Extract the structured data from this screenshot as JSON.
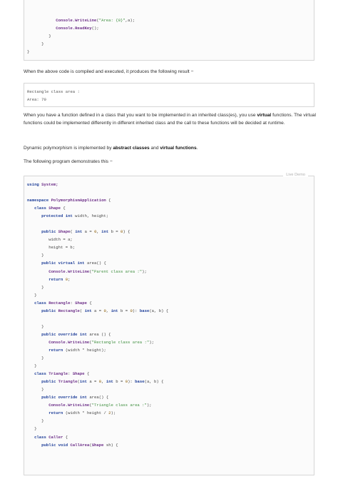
{
  "top_code": {
    "lines": [
      {
        "segs": [
          {
            "t": "            ",
            "c": ""
          },
          {
            "t": "Console.WriteLine",
            "c": "ty"
          },
          {
            "t": "(",
            "c": ""
          },
          {
            "t": "\"Area: {0}\"",
            "c": "str"
          },
          {
            "t": ",a);",
            "c": ""
          }
        ]
      },
      {
        "segs": [
          {
            "t": "            ",
            "c": ""
          },
          {
            "t": "Console.ReadKey",
            "c": "ty"
          },
          {
            "t": "();",
            "c": ""
          }
        ]
      },
      {
        "segs": [
          {
            "t": "         }",
            "c": ""
          }
        ]
      },
      {
        "segs": [
          {
            "t": "      }",
            "c": ""
          }
        ]
      },
      {
        "segs": [
          {
            "t": "}",
            "c": ""
          }
        ]
      }
    ]
  },
  "intro_text": "When the above code is compiled and executed, it produces the following result −",
  "result_box": {
    "lines": [
      {
        "segs": [
          {
            "t": "Rectangle class area :",
            "c": ""
          }
        ]
      },
      {
        "segs": [
          {
            "t": "Area: 70",
            "c": ""
          }
        ]
      }
    ]
  },
  "para1": {
    "before": "When you have a function defined in a class that you want to be implemented in an inherited class(es), you use ",
    "bold": "virtual",
    "after": " functions. The virtual functions could be implemented differently in different inherited class and the call to these functions will be decided at runtime."
  },
  "para2": {
    "before": "Dynamic polymorphism is implemented by ",
    "bold1": "abstract classes",
    "middle": " and ",
    "bold2": "virtual functions",
    "after": "."
  },
  "para3": "The following program demonstrates this −",
  "live_demo_label": "Live Demo",
  "main_code": {
    "lines": [
      {
        "segs": [
          {
            "t": "using",
            "c": "kw"
          },
          {
            "t": " ",
            "c": ""
          },
          {
            "t": "System;",
            "c": "ty"
          }
        ]
      },
      {
        "segs": []
      },
      {
        "segs": [
          {
            "t": "namespace",
            "c": "kw"
          },
          {
            "t": " ",
            "c": ""
          },
          {
            "t": "PolymorphismApplication",
            "c": "ty"
          },
          {
            "t": " {",
            "c": ""
          }
        ]
      },
      {
        "segs": [
          {
            "t": "   ",
            "c": ""
          },
          {
            "t": "class",
            "c": "kw"
          },
          {
            "t": " ",
            "c": ""
          },
          {
            "t": "Shape",
            "c": "ty"
          },
          {
            "t": " {",
            "c": ""
          }
        ]
      },
      {
        "segs": [
          {
            "t": "      ",
            "c": ""
          },
          {
            "t": "protected",
            "c": "kw"
          },
          {
            "t": " ",
            "c": ""
          },
          {
            "t": "int",
            "c": "kw"
          },
          {
            "t": " width, height;",
            "c": ""
          }
        ]
      },
      {
        "segs": []
      },
      {
        "segs": [
          {
            "t": "      ",
            "c": ""
          },
          {
            "t": "public",
            "c": "kw"
          },
          {
            "t": " ",
            "c": ""
          },
          {
            "t": "Shape",
            "c": "ty"
          },
          {
            "t": "( ",
            "c": ""
          },
          {
            "t": "int",
            "c": "kw"
          },
          {
            "t": " a = ",
            "c": ""
          },
          {
            "t": "0",
            "c": "num"
          },
          {
            "t": ", ",
            "c": ""
          },
          {
            "t": "int",
            "c": "kw"
          },
          {
            "t": " b = ",
            "c": ""
          },
          {
            "t": "0",
            "c": "num"
          },
          {
            "t": ") {",
            "c": ""
          }
        ]
      },
      {
        "segs": [
          {
            "t": "         width = a;",
            "c": ""
          }
        ]
      },
      {
        "segs": [
          {
            "t": "         height = b;",
            "c": ""
          }
        ]
      },
      {
        "segs": [
          {
            "t": "      }",
            "c": ""
          }
        ]
      },
      {
        "segs": [
          {
            "t": "      ",
            "c": ""
          },
          {
            "t": "public",
            "c": "kw"
          },
          {
            "t": " ",
            "c": ""
          },
          {
            "t": "virtual",
            "c": "kw"
          },
          {
            "t": " ",
            "c": ""
          },
          {
            "t": "int",
            "c": "kw"
          },
          {
            "t": " area() {",
            "c": ""
          }
        ]
      },
      {
        "segs": [
          {
            "t": "         ",
            "c": ""
          },
          {
            "t": "Console.WriteLine",
            "c": "ty"
          },
          {
            "t": "(",
            "c": ""
          },
          {
            "t": "\"Parent class area :\"",
            "c": "str"
          },
          {
            "t": ");",
            "c": ""
          }
        ]
      },
      {
        "segs": [
          {
            "t": "         ",
            "c": ""
          },
          {
            "t": "return",
            "c": "kw"
          },
          {
            "t": " ",
            "c": ""
          },
          {
            "t": "0",
            "c": "num"
          },
          {
            "t": ";",
            "c": ""
          }
        ]
      },
      {
        "segs": [
          {
            "t": "      }",
            "c": ""
          }
        ]
      },
      {
        "segs": [
          {
            "t": "   }",
            "c": ""
          }
        ]
      },
      {
        "segs": [
          {
            "t": "   ",
            "c": ""
          },
          {
            "t": "class",
            "c": "kw"
          },
          {
            "t": " ",
            "c": ""
          },
          {
            "t": "Rectangle",
            "c": "ty"
          },
          {
            "t": ": ",
            "c": ""
          },
          {
            "t": "Shape",
            "c": "ty"
          },
          {
            "t": " {",
            "c": ""
          }
        ]
      },
      {
        "segs": [
          {
            "t": "      ",
            "c": ""
          },
          {
            "t": "public",
            "c": "kw"
          },
          {
            "t": " ",
            "c": ""
          },
          {
            "t": "Rectangle",
            "c": "ty"
          },
          {
            "t": "( ",
            "c": ""
          },
          {
            "t": "int",
            "c": "kw"
          },
          {
            "t": " a = ",
            "c": ""
          },
          {
            "t": "0",
            "c": "num"
          },
          {
            "t": ", ",
            "c": ""
          },
          {
            "t": "int",
            "c": "kw"
          },
          {
            "t": " b = ",
            "c": ""
          },
          {
            "t": "0",
            "c": "num"
          },
          {
            "t": "): ",
            "c": ""
          },
          {
            "t": "base",
            "c": "kw"
          },
          {
            "t": "(a, b) {",
            "c": ""
          }
        ]
      },
      {
        "segs": []
      },
      {
        "segs": [
          {
            "t": "      }",
            "c": ""
          }
        ]
      },
      {
        "segs": [
          {
            "t": "      ",
            "c": ""
          },
          {
            "t": "public",
            "c": "kw"
          },
          {
            "t": " ",
            "c": ""
          },
          {
            "t": "override",
            "c": "kw"
          },
          {
            "t": " ",
            "c": ""
          },
          {
            "t": "int",
            "c": "kw"
          },
          {
            "t": " area () {",
            "c": ""
          }
        ]
      },
      {
        "segs": [
          {
            "t": "         ",
            "c": ""
          },
          {
            "t": "Console.WriteLine",
            "c": "ty"
          },
          {
            "t": "(",
            "c": ""
          },
          {
            "t": "\"Rectangle class area :\"",
            "c": "str"
          },
          {
            "t": ");",
            "c": ""
          }
        ]
      },
      {
        "segs": [
          {
            "t": "         ",
            "c": ""
          },
          {
            "t": "return",
            "c": "kw"
          },
          {
            "t": " (width * height);",
            "c": ""
          }
        ]
      },
      {
        "segs": [
          {
            "t": "      }",
            "c": ""
          }
        ]
      },
      {
        "segs": [
          {
            "t": "   }",
            "c": ""
          }
        ]
      },
      {
        "segs": [
          {
            "t": "   ",
            "c": ""
          },
          {
            "t": "class",
            "c": "kw"
          },
          {
            "t": " ",
            "c": ""
          },
          {
            "t": "Triangle",
            "c": "ty"
          },
          {
            "t": ": ",
            "c": ""
          },
          {
            "t": "Shape",
            "c": "ty"
          },
          {
            "t": " {",
            "c": ""
          }
        ]
      },
      {
        "segs": [
          {
            "t": "      ",
            "c": ""
          },
          {
            "t": "public",
            "c": "kw"
          },
          {
            "t": " ",
            "c": ""
          },
          {
            "t": "Triangle",
            "c": "ty"
          },
          {
            "t": "(",
            "c": ""
          },
          {
            "t": "int",
            "c": "kw"
          },
          {
            "t": " a = ",
            "c": ""
          },
          {
            "t": "0",
            "c": "num"
          },
          {
            "t": ", ",
            "c": ""
          },
          {
            "t": "int",
            "c": "kw"
          },
          {
            "t": " b = ",
            "c": ""
          },
          {
            "t": "0",
            "c": "num"
          },
          {
            "t": "): ",
            "c": ""
          },
          {
            "t": "base",
            "c": "kw"
          },
          {
            "t": "(a, b) {",
            "c": ""
          }
        ]
      },
      {
        "segs": [
          {
            "t": "      }",
            "c": ""
          }
        ]
      },
      {
        "segs": [
          {
            "t": "      ",
            "c": ""
          },
          {
            "t": "public",
            "c": "kw"
          },
          {
            "t": " ",
            "c": ""
          },
          {
            "t": "override",
            "c": "kw"
          },
          {
            "t": " ",
            "c": ""
          },
          {
            "t": "int",
            "c": "kw"
          },
          {
            "t": " area() {",
            "c": ""
          }
        ]
      },
      {
        "segs": [
          {
            "t": "         ",
            "c": ""
          },
          {
            "t": "Console.WriteLine",
            "c": "ty"
          },
          {
            "t": "(",
            "c": ""
          },
          {
            "t": "\"Triangle class area :\"",
            "c": "str"
          },
          {
            "t": ");",
            "c": ""
          }
        ]
      },
      {
        "segs": [
          {
            "t": "         ",
            "c": ""
          },
          {
            "t": "return",
            "c": "kw"
          },
          {
            "t": " (width * height / ",
            "c": ""
          },
          {
            "t": "2",
            "c": "num"
          },
          {
            "t": ");",
            "c": ""
          }
        ]
      },
      {
        "segs": [
          {
            "t": "      }",
            "c": ""
          }
        ]
      },
      {
        "segs": [
          {
            "t": "   }",
            "c": ""
          }
        ]
      },
      {
        "segs": [
          {
            "t": "   ",
            "c": ""
          },
          {
            "t": "class",
            "c": "kw"
          },
          {
            "t": " ",
            "c": ""
          },
          {
            "t": "Caller",
            "c": "ty"
          },
          {
            "t": " {",
            "c": ""
          }
        ]
      },
      {
        "segs": [
          {
            "t": "      ",
            "c": ""
          },
          {
            "t": "public",
            "c": "kw"
          },
          {
            "t": " ",
            "c": ""
          },
          {
            "t": "void",
            "c": "kw"
          },
          {
            "t": " ",
            "c": ""
          },
          {
            "t": "CallArea",
            "c": "ty"
          },
          {
            "t": "(",
            "c": ""
          },
          {
            "t": "Shape",
            "c": "ty"
          },
          {
            "t": " sh) {",
            "c": ""
          }
        ]
      }
    ]
  }
}
